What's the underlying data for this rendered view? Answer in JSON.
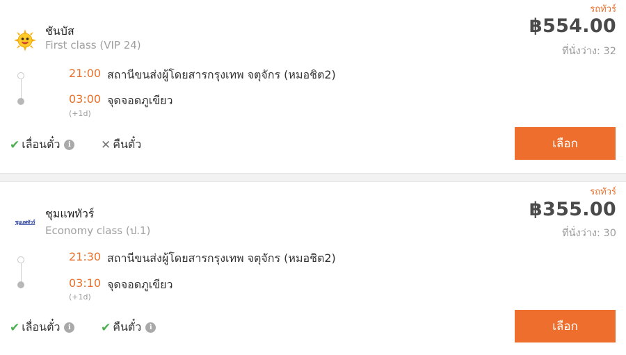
{
  "trips": [
    {
      "tag": "รถทัวร์",
      "operator": "ชันบัส",
      "bus_class": "First class (VIP 24)",
      "price": "฿554.00",
      "seats": "ที่นั่งว่าง: 32",
      "logo_icon": "sun-mascot-icon",
      "depart_time": "21:00",
      "depart_station": "สถานีขนส่งผู้โดยสารกรุงเทพ จตุจักร (หมอชิต2)",
      "arrive_time": "03:00",
      "arrive_station": "จุดจอดภูเขียว",
      "next_day": "(+1d)",
      "reschedule_label": "เลื่อนตั๋ว",
      "reschedule_ok": true,
      "refund_label": "คืนตั๋ว",
      "refund_ok": false,
      "select_label": "เลือก"
    },
    {
      "tag": "รถทัวร์",
      "operator": "ชุมแพทัวร์",
      "bus_class": "Economy class (ป.1)",
      "price": "฿355.00",
      "seats": "ที่นั่งว่าง: 30",
      "logo_icon": "chumphae-tour-logo",
      "logo_text": "ชุมแพทัวร์",
      "depart_time": "21:30",
      "depart_station": "สถานีขนส่งผู้โดยสารกรุงเทพ จตุจักร (หมอชิต2)",
      "arrive_time": "03:10",
      "arrive_station": "จุดจอดภูเขียว",
      "next_day": "(+1d)",
      "reschedule_label": "เลื่อนตั๋ว",
      "reschedule_ok": true,
      "refund_label": "คืนตั๋ว",
      "refund_ok": true,
      "select_label": "เลือก"
    }
  ],
  "icons": {
    "check": "check-icon",
    "cross": "cross-icon",
    "info": "info-icon"
  },
  "colors": {
    "accent": "#ee6f2d",
    "time": "#e8702a",
    "check": "#4caf50"
  }
}
